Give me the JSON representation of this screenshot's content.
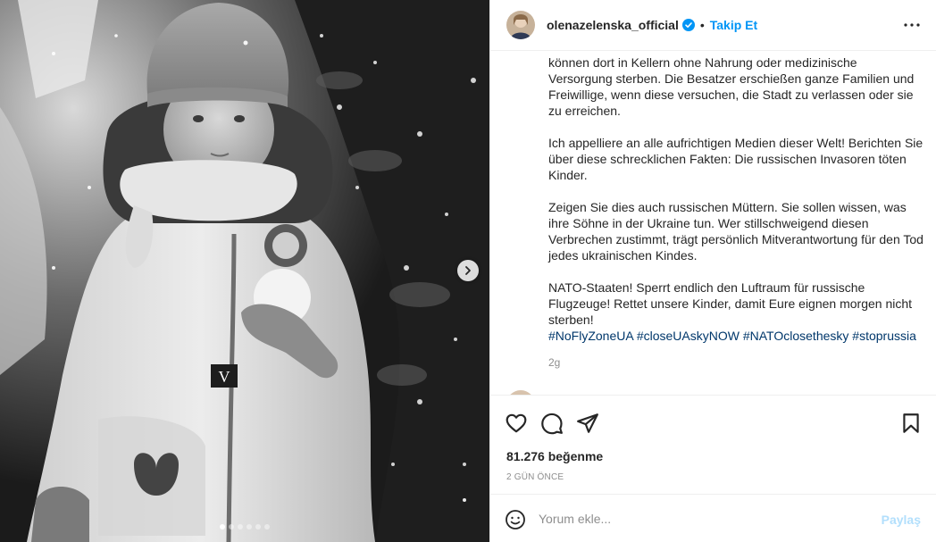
{
  "header": {
    "username": "olenazelenska_official",
    "separator": "•",
    "follow_label": "Takip Et",
    "more_icon": "more-horizontal-icon",
    "verified_icon": "verified-badge-icon",
    "verified_color": "#0095f6"
  },
  "caption": {
    "paragraphs": [
      "können dort in Kellern ohne Nahrung oder medizinische Versorgung sterben. Die Besatzer erschießen ganze Familien und Freiwillige, wenn diese versuchen, die Stadt zu verlassen oder sie zu erreichen.",
      "Ich appelliere an alle aufrichtigen Medien dieser Welt! Berichten Sie über diese schrecklichen Fakten: Die russischen Invasoren töten Kinder.",
      "Zeigen Sie dies auch russischen Müttern. Sie sollen wissen, was ihre Söhne in der Ukraine tun. Wer stillschweigend diesen Verbrechen zustimmt, trägt persönlich Mitverantwortung für den Tod jedes ukrainischen Kindes.",
      "NATO-Staaten! Sperrt endlich den Luftraum für russische Flugzeuge! Rettet unsere Kinder, damit Eure eignen morgen nicht sterben!"
    ],
    "hashtags": [
      "#NoFlyZoneUA",
      "#closeUAskyNOW",
      "#NATOclosethesky",
      "#stoprussia"
    ],
    "time": "2g"
  },
  "actions": {
    "like_icon": "heart-icon",
    "comment_icon": "comment-bubble-icon",
    "share_icon": "paper-plane-icon",
    "save_icon": "bookmark-icon"
  },
  "likes": "81.276 beğenme",
  "date": "2 GÜN ÖNCE",
  "add_comment": {
    "emoji_icon": "emoji-smile-icon",
    "placeholder": "Yorum ekle...",
    "post_label": "Paylaş",
    "post_color": "#b2dffc"
  },
  "carousel": {
    "next_icon": "chevron-right-icon",
    "slide_count": 6,
    "active_index": 0
  },
  "colors": {
    "link": "#0095f6",
    "hashtag": "#00376b",
    "muted": "#8e8e8e",
    "text": "#262626",
    "border": "#efefef"
  }
}
